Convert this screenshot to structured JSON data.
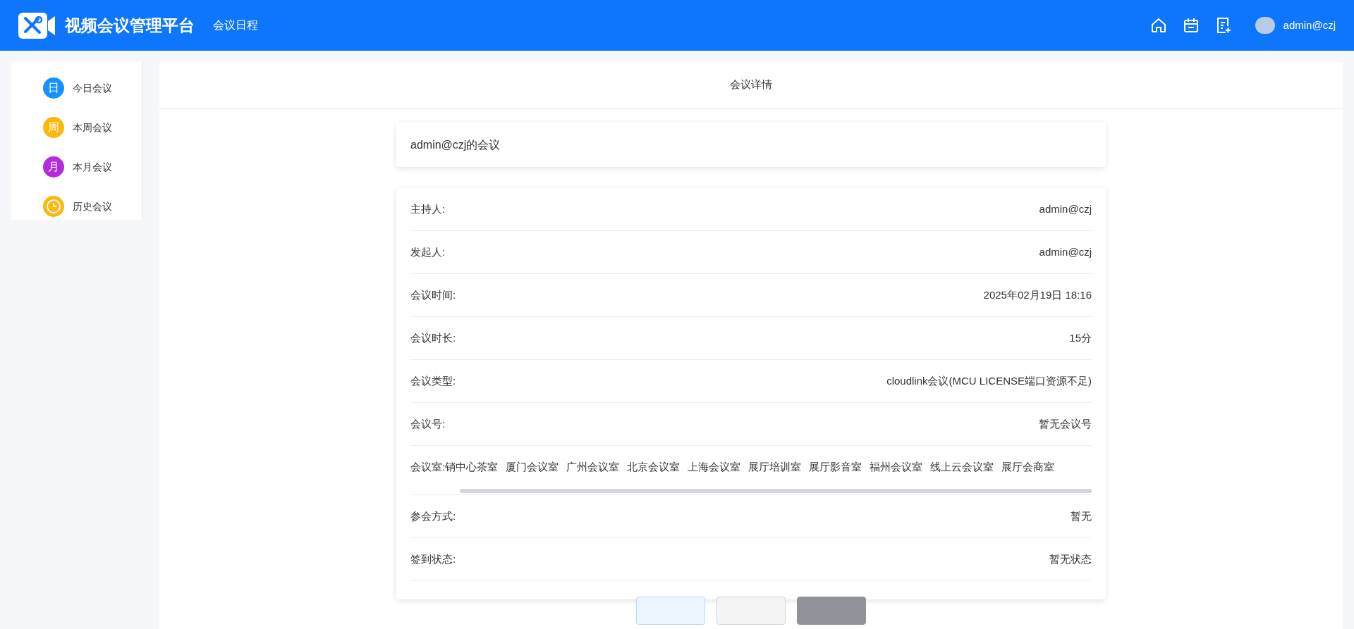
{
  "header": {
    "title": "视频会议管理平台",
    "nav": "会议日程",
    "user": "admin@czj"
  },
  "sidebar": {
    "items": [
      {
        "glyph": "日",
        "label": "今日会议",
        "color": "#1890ff",
        "kind": "text"
      },
      {
        "glyph": "周",
        "label": "本周会议",
        "color": "#fbb70a",
        "kind": "text"
      },
      {
        "glyph": "月",
        "label": "本月会议",
        "color": "#b42bdc",
        "kind": "text"
      },
      {
        "label": "历史会议",
        "color": "#fbb70a",
        "kind": "clock"
      }
    ]
  },
  "page_title": "会议详情",
  "meeting_name": "admin@czj的会议",
  "details": [
    {
      "label": "主持人:",
      "value": "admin@czj"
    },
    {
      "label": "发起人:",
      "value": "admin@czj"
    },
    {
      "label": "会议时间:",
      "value": "2025年02月19日 18:16"
    },
    {
      "label": "会议时长:",
      "value": "15分"
    },
    {
      "label": "会议类型:",
      "value": "cloudlink会议(MCU LICENSE端口资源不足)"
    },
    {
      "label": "会议号:",
      "value": "暂无会议号"
    }
  ],
  "rooms": {
    "label": "会议室:",
    "items": [
      "销中心茶室",
      "厦门会议室",
      "广州会议室",
      "北京会议室",
      "上海会议室",
      "展厅培训室",
      "展厅影音室",
      "福州会议室",
      "线上云会议室",
      "展厅会商室"
    ]
  },
  "details_after": [
    {
      "label": "参会方式:",
      "value": "暂无"
    },
    {
      "label": "签到状态:",
      "value": "暂无状态"
    }
  ],
  "buttons": [
    {
      "kind": "primary"
    },
    {
      "kind": "default"
    },
    {
      "kind": "dark"
    }
  ]
}
